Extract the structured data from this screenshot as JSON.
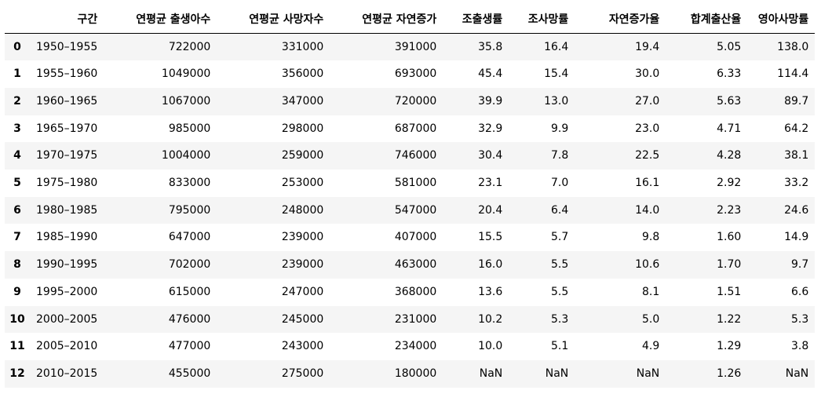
{
  "table": {
    "index_header": "",
    "columns": [
      "구간",
      "연평균 출생아수",
      "연평균 사망자수",
      "연평균 자연증가",
      "조출생률",
      "조사망률",
      "자연증가율",
      "합계출산율",
      "영아사망률"
    ],
    "rows": [
      {
        "index": "0",
        "cells": [
          "1950–1955",
          "722000",
          "331000",
          "391000",
          "35.8",
          "16.4",
          "19.4",
          "5.05",
          "138.0"
        ]
      },
      {
        "index": "1",
        "cells": [
          "1955–1960",
          "1049000",
          "356000",
          "693000",
          "45.4",
          "15.4",
          "30.0",
          "6.33",
          "114.4"
        ]
      },
      {
        "index": "2",
        "cells": [
          "1960–1965",
          "1067000",
          "347000",
          "720000",
          "39.9",
          "13.0",
          "27.0",
          "5.63",
          "89.7"
        ]
      },
      {
        "index": "3",
        "cells": [
          "1965–1970",
          "985000",
          "298000",
          "687000",
          "32.9",
          "9.9",
          "23.0",
          "4.71",
          "64.2"
        ]
      },
      {
        "index": "4",
        "cells": [
          "1970–1975",
          "1004000",
          "259000",
          "746000",
          "30.4",
          "7.8",
          "22.5",
          "4.28",
          "38.1"
        ]
      },
      {
        "index": "5",
        "cells": [
          "1975–1980",
          "833000",
          "253000",
          "581000",
          "23.1",
          "7.0",
          "16.1",
          "2.92",
          "33.2"
        ]
      },
      {
        "index": "6",
        "cells": [
          "1980–1985",
          "795000",
          "248000",
          "547000",
          "20.4",
          "6.4",
          "14.0",
          "2.23",
          "24.6"
        ]
      },
      {
        "index": "7",
        "cells": [
          "1985–1990",
          "647000",
          "239000",
          "407000",
          "15.5",
          "5.7",
          "9.8",
          "1.60",
          "14.9"
        ]
      },
      {
        "index": "8",
        "cells": [
          "1990–1995",
          "702000",
          "239000",
          "463000",
          "16.0",
          "5.5",
          "10.6",
          "1.70",
          "9.7"
        ]
      },
      {
        "index": "9",
        "cells": [
          "1995–2000",
          "615000",
          "247000",
          "368000",
          "13.6",
          "5.5",
          "8.1",
          "1.51",
          "6.6"
        ]
      },
      {
        "index": "10",
        "cells": [
          "2000–2005",
          "476000",
          "245000",
          "231000",
          "10.2",
          "5.3",
          "5.0",
          "1.22",
          "5.3"
        ]
      },
      {
        "index": "11",
        "cells": [
          "2005–2010",
          "477000",
          "243000",
          "234000",
          "10.0",
          "5.1",
          "4.9",
          "1.29",
          "3.8"
        ]
      },
      {
        "index": "12",
        "cells": [
          "2010–2015",
          "455000",
          "275000",
          "180000",
          "NaN",
          "NaN",
          "NaN",
          "1.26",
          "NaN"
        ]
      }
    ]
  },
  "colors": {
    "row_stripe": "#f5f5f5",
    "row_plain": "#ffffff",
    "row_hover": "#e1f0fb",
    "header_rule": "#000000"
  }
}
